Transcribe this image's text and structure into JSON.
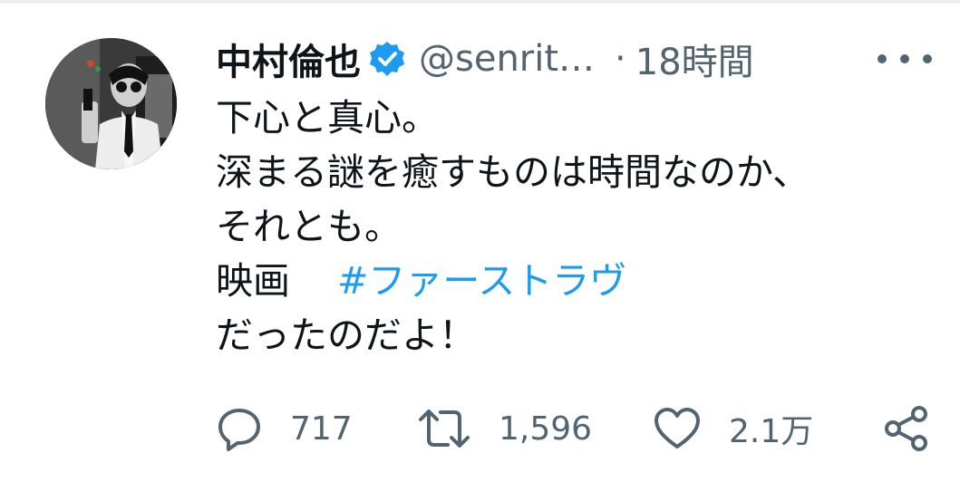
{
  "tweet": {
    "display_name": "中村倫也",
    "handle": "@senrit…",
    "separator": "·",
    "timestamp": "18時間",
    "lines": [
      "下心と真心。",
      "深まる謎を癒すものは時間なのか、",
      "それとも。"
    ],
    "line4_prefix": "映画",
    "hashtag": "#ファーストラヴ",
    "last_line": "だったのだよ！"
  },
  "actions": {
    "reply_count": "717",
    "retweet_count": "1,596",
    "like_count": "2.1万"
  },
  "icons": {
    "verified": "verified-badge-icon",
    "more": "more-icon",
    "reply": "reply-icon",
    "retweet": "retweet-icon",
    "like": "heart-icon",
    "share": "share-icon"
  },
  "colors": {
    "text": "#0f1419",
    "secondary": "#536471",
    "accent": "#1d9bf0"
  }
}
